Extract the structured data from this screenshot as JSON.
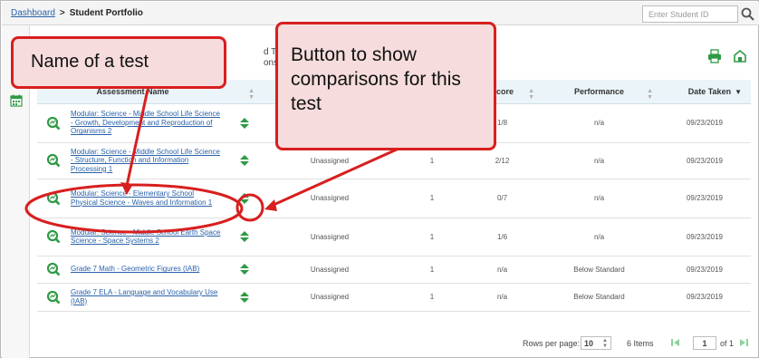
{
  "breadcrumb": {
    "home": "Dashboard",
    "separator": ">",
    "current": "Student Portfolio"
  },
  "search": {
    "placeholder": "Enter Student ID",
    "icon": "search-icon"
  },
  "toolbar": {
    "reason_partial_1": "d Test Reas",
    "reason_partial_2": "ons",
    "icons": [
      "print-icon",
      "share-icon"
    ]
  },
  "table": {
    "columns": {
      "name": "Assessment Name",
      "score": "Score",
      "performance": "Performance",
      "date": "Date Taken"
    },
    "rows": [
      {
        "name": "Modular: Science - Middle School Life Science - Growth, Development and Reproduction of Organisms 2",
        "status": "",
        "attempts": "",
        "score": "1/8",
        "performance": "n/a",
        "date": "09/23/2019"
      },
      {
        "name": "Modular: Science - Middle School Life Science - Structure, Function and Information Processing 1",
        "status": "Unassigned",
        "attempts": "1",
        "score": "2/12",
        "performance": "n/a",
        "date": "09/23/2019"
      },
      {
        "name": "Modular: Science - Elementary School Physical Science - Waves and Information 1",
        "status": "Unassigned",
        "attempts": "1",
        "score": "0/7",
        "performance": "n/a",
        "date": "09/23/2019"
      },
      {
        "name": "Modular: Science - Middle School Earth Space Science - Space Systems 2",
        "status": "Unassigned",
        "attempts": "1",
        "score": "1/6",
        "performance": "n/a",
        "date": "09/23/2019"
      },
      {
        "name": "Grade 7 Math - Geometric Figures (IAB)",
        "status": "Unassigned",
        "attempts": "1",
        "score": "n/a",
        "performance": "Below Standard",
        "date": "09/23/2019"
      },
      {
        "name": "Grade 7 ELA - Language and Vocabulary Use (IAB)",
        "status": "Unassigned",
        "attempts": "1",
        "score": "n/a",
        "performance": "Below Standard",
        "date": "09/23/2019"
      }
    ]
  },
  "footer": {
    "rows_per_page_label": "Rows per page:",
    "rows_per_page_value": "10",
    "items": "6 Items",
    "page": "1",
    "of": "of 1"
  },
  "callouts": {
    "test_name": "Name of a test",
    "compare_button": "Button to show comparisons for this test"
  },
  "colors": {
    "accent_red": "#d81f1f",
    "callout_fill": "#f6dcdc",
    "link": "#2a62a8",
    "header_bg": "#eaf4f9",
    "icon_green": "#2e9a45"
  }
}
